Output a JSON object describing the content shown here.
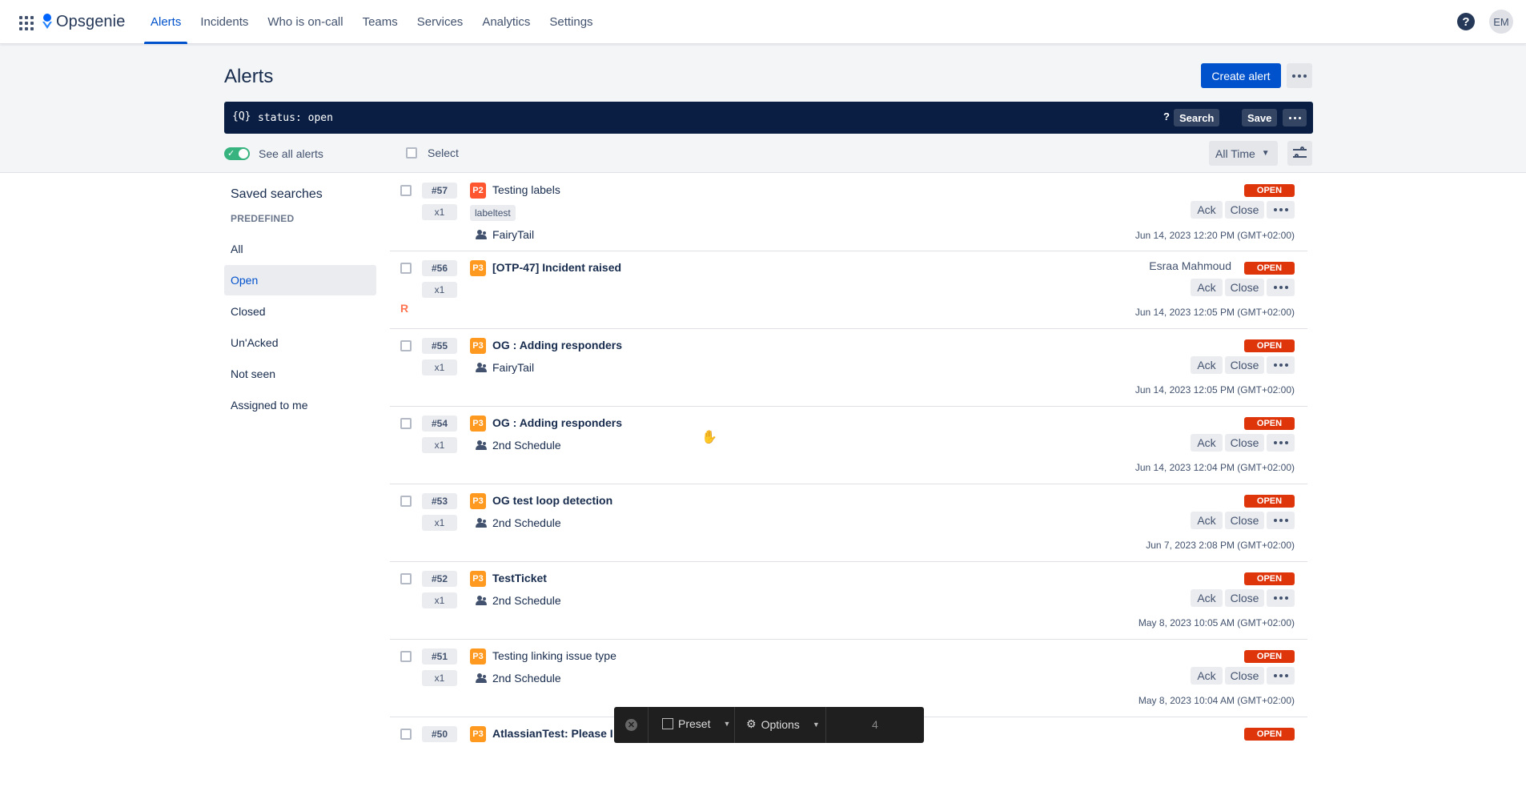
{
  "app": {
    "name": "Opsgenie"
  },
  "nav": [
    "Alerts",
    "Incidents",
    "Who is on-call",
    "Teams",
    "Services",
    "Analytics",
    "Settings"
  ],
  "nav_active": "Alerts",
  "user": {
    "initials": "EM"
  },
  "help": {
    "label": "?"
  },
  "page": {
    "title": "Alerts",
    "create_label": "Create alert"
  },
  "search": {
    "icon": "{Q}",
    "query": "status: open",
    "help": "?",
    "search_label": "Search",
    "save_label": "Save"
  },
  "toolbar": {
    "toggle_label": "See all alerts",
    "toggle_on": true,
    "select_label": "Select",
    "time_filter": "All Time"
  },
  "sidebar": {
    "title": "Saved searches",
    "section": "PREDEFINED",
    "items": [
      "All",
      "Open",
      "Closed",
      "Un'Acked",
      "Not seen",
      "Assigned to me"
    ],
    "active": "Open"
  },
  "actions": {
    "ack": "Ack",
    "close": "Close"
  },
  "alerts": [
    {
      "id": "#57",
      "count": "x1",
      "priority": "P2",
      "title": "Testing labels",
      "bold": false,
      "label": "labeltest",
      "team": "FairyTail",
      "status": "OPEN",
      "owner": "",
      "marker": "",
      "time": "Jun 14, 2023 12:20 PM (GMT+02:00)"
    },
    {
      "id": "#56",
      "count": "x1",
      "priority": "P3",
      "title": "[OTP-47] Incident raised",
      "bold": true,
      "label": "",
      "team": "",
      "status": "OPEN",
      "owner": "Esraa Mahmoud",
      "marker": "R",
      "time": "Jun 14, 2023 12:05 PM (GMT+02:00)"
    },
    {
      "id": "#55",
      "count": "x1",
      "priority": "P3",
      "title": "OG : Adding responders",
      "bold": true,
      "label": "",
      "team": "FairyTail",
      "status": "OPEN",
      "owner": "",
      "marker": "",
      "time": "Jun 14, 2023 12:05 PM (GMT+02:00)"
    },
    {
      "id": "#54",
      "count": "x1",
      "priority": "P3",
      "title": "OG : Adding responders",
      "bold": true,
      "label": "",
      "team": "2nd Schedule",
      "status": "OPEN",
      "owner": "",
      "marker": "",
      "time": "Jun 14, 2023 12:04 PM (GMT+02:00)"
    },
    {
      "id": "#53",
      "count": "x1",
      "priority": "P3",
      "title": "OG test loop detection",
      "bold": true,
      "label": "",
      "team": "2nd Schedule",
      "status": "OPEN",
      "owner": "",
      "marker": "",
      "time": "Jun 7, 2023 2:08 PM (GMT+02:00)"
    },
    {
      "id": "#52",
      "count": "x1",
      "priority": "P3",
      "title": "TestTicket",
      "bold": true,
      "label": "",
      "team": "2nd Schedule",
      "status": "OPEN",
      "owner": "",
      "marker": "",
      "time": "May 8, 2023 10:05 AM (GMT+02:00)"
    },
    {
      "id": "#51",
      "count": "x1",
      "priority": "P3",
      "title": "Testing linking issue type",
      "bold": false,
      "label": "",
      "team": "2nd Schedule",
      "status": "OPEN",
      "owner": "",
      "marker": "",
      "time": "May 8, 2023 10:04 AM (GMT+02:00)"
    },
    {
      "id": "#50",
      "count": "",
      "priority": "P3",
      "title": "AtlassianTest: Please I",
      "bold": true,
      "label": "",
      "team": "",
      "status": "OPEN",
      "owner": "",
      "marker": "",
      "time": ""
    }
  ],
  "recorder": {
    "preset_label": "Preset",
    "options_label": "Options",
    "count": "4"
  },
  "colors": {
    "accent": "#0052cc",
    "nav_bg": "#ffffff",
    "search_bg": "#091e42",
    "open_badge": "#de350b",
    "p2": "#ff5630",
    "p3": "#ff991f",
    "toggle_on": "#36b37e"
  }
}
